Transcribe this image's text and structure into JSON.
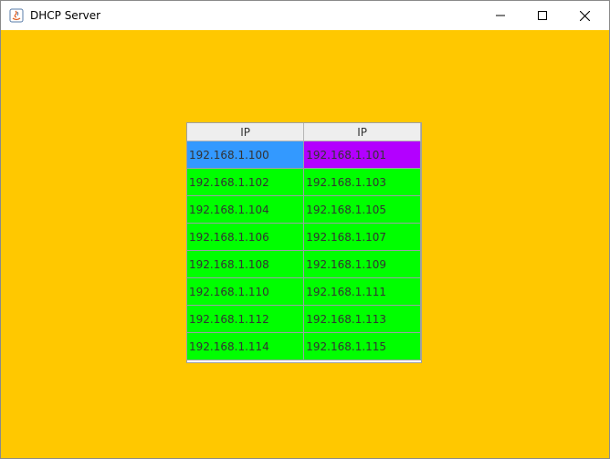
{
  "window": {
    "title": "DHCP Server"
  },
  "colors": {
    "background": "#ffc800",
    "assigned": "#00ff00",
    "selected": "#3399ff",
    "highlight": "#b300ff"
  },
  "table": {
    "headers": [
      "IP",
      "IP"
    ],
    "rows": [
      [
        "192.168.1.100",
        "192.168.1.101"
      ],
      [
        "192.168.1.102",
        "192.168.1.103"
      ],
      [
        "192.168.1.104",
        "192.168.1.105"
      ],
      [
        "192.168.1.106",
        "192.168.1.107"
      ],
      [
        "192.168.1.108",
        "192.168.1.109"
      ],
      [
        "192.168.1.110",
        "192.168.1.111"
      ],
      [
        "192.168.1.112",
        "192.168.1.113"
      ],
      [
        "192.168.1.114",
        "192.168.1.115"
      ]
    ]
  }
}
